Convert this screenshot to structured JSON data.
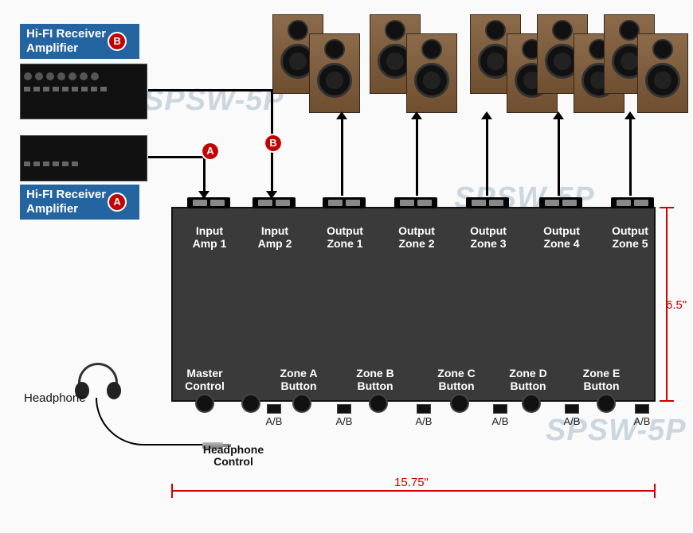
{
  "model_watermark": "SPSW-5P",
  "receiver_b": {
    "line1": "Hi-FI Receiver",
    "line2": "Amplifier",
    "marker": "B"
  },
  "receiver_a": {
    "line1": "Hi-FI Receiver",
    "line2": "Amplifier",
    "marker": "A"
  },
  "unit": {
    "top_ports": [
      {
        "label": "Input\nAmp 1"
      },
      {
        "label": "Input\nAmp 2"
      },
      {
        "label": "Output\nZone 1"
      },
      {
        "label": "Output\nZone 2"
      },
      {
        "label": "Output\nZone 3"
      },
      {
        "label": "Output\nZone 4"
      },
      {
        "label": "Output\nZone 5"
      }
    ],
    "bottom": {
      "master": "Master\nControl",
      "zones": [
        "Zone A\nButton",
        "Zone B\nButton",
        "Zone C\nButton",
        "Zone D\nButton",
        "Zone E\nButton"
      ],
      "ab_label": "A/B"
    }
  },
  "headphone": {
    "label": "Headphone",
    "control": "Headphone\nControl"
  },
  "dimensions": {
    "width": "15.75\"",
    "height": "6.5\""
  },
  "markers": {
    "a": "A",
    "b": "B"
  }
}
